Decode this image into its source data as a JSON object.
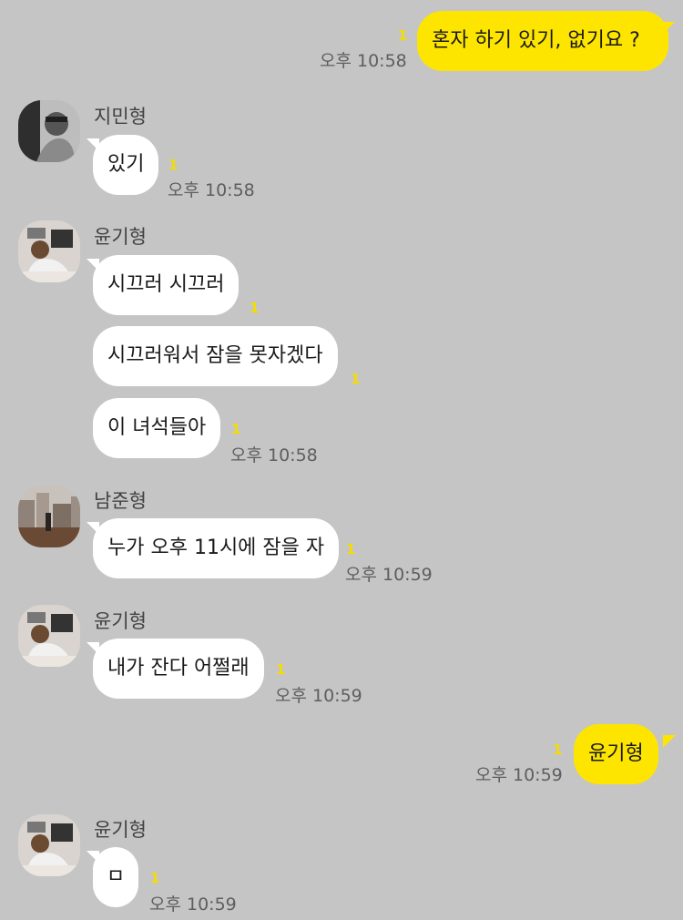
{
  "messages": {
    "m1": {
      "text": "혼자 하기 있기, 없기요 ?",
      "time": "오후 10:58",
      "unread": "1"
    },
    "m2": {
      "sender": "지민형",
      "text": "있기",
      "time": "오후 10:58",
      "unread": "1"
    },
    "m3": {
      "sender": "윤기형",
      "lines": [
        "시끄러 시끄러",
        "시끄러워서 잠을 못자겠다",
        "이 녀석들아"
      ],
      "unread": [
        "1",
        "1",
        "1"
      ],
      "time": "오후 10:58"
    },
    "m4": {
      "sender": "남준형",
      "text": "누가 오후 11시에 잠을 자",
      "time": "오후 10:59",
      "unread": "1"
    },
    "m5": {
      "sender": "윤기형",
      "text": "내가 잔다 어쩔래",
      "time": "오후 10:59",
      "unread": "1"
    },
    "m6": {
      "text": "윤기형",
      "time": "오후 10:59",
      "unread": "1"
    },
    "m7": {
      "sender": "윤기형",
      "text": "ㅁ",
      "time": "오후 10:59",
      "unread": "1"
    }
  },
  "colors": {
    "background": "#c5c5c5",
    "incoming_bubble": "#ffffff",
    "outgoing_bubble": "#fee500",
    "unread_count": "#f5dc00"
  },
  "avatars": {
    "jimin": "grayscale-portrait-avatar",
    "yoongi": "person-at-desk-avatar",
    "namjoon": "cityscape-avatar"
  }
}
